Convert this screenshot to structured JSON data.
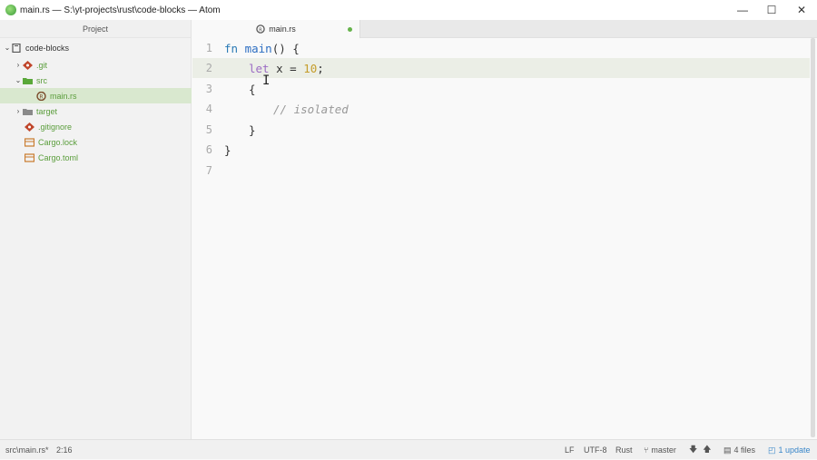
{
  "window": {
    "title": "main.rs — S:\\yt-projects\\rust\\code-blocks — Atom",
    "min_icon": "minimize-icon",
    "max_icon": "maximize-icon",
    "close_icon": "close-icon"
  },
  "tree": {
    "header": "Project",
    "items": [
      {
        "label": "code-blocks",
        "icon": "repo-icon",
        "expanded": true
      },
      {
        "label": ".git",
        "icon": "git-icon"
      },
      {
        "label": "src",
        "icon": "folder-icon",
        "expanded": true
      },
      {
        "label": "main.rs",
        "icon": "rust-file-icon",
        "selected": true
      },
      {
        "label": "target",
        "icon": "folder-icon"
      },
      {
        "label": ".gitignore",
        "icon": "git-icon"
      },
      {
        "label": "Cargo.lock",
        "icon": "package-icon"
      },
      {
        "label": "Cargo.toml",
        "icon": "package-icon"
      }
    ]
  },
  "tab": {
    "label": "main.rs",
    "modified": true
  },
  "editor": {
    "line_numbers": [
      "1",
      "2",
      "3",
      "4",
      "5",
      "6",
      "7"
    ],
    "lines": {
      "l1_fn": "fn",
      "l1_name": "main",
      "l1_rest": "() {",
      "l2_kw": "let",
      "l2_mid": " x = ",
      "l2_num": "10",
      "l2_end": ";",
      "l3": "{",
      "l4": "// isolated",
      "l5": "}",
      "l6": "}",
      "l7": ""
    }
  },
  "status": {
    "path": "src\\main.rs*",
    "cursor": "2:16",
    "line_ending": "LF",
    "encoding": "UTF-8",
    "grammar": "Rust",
    "branch": "master",
    "files": "4 files",
    "update": "1 update"
  },
  "colors": {
    "accent": "#66b34b",
    "selection": "#d9e8cf",
    "link": "#3a87c9"
  }
}
